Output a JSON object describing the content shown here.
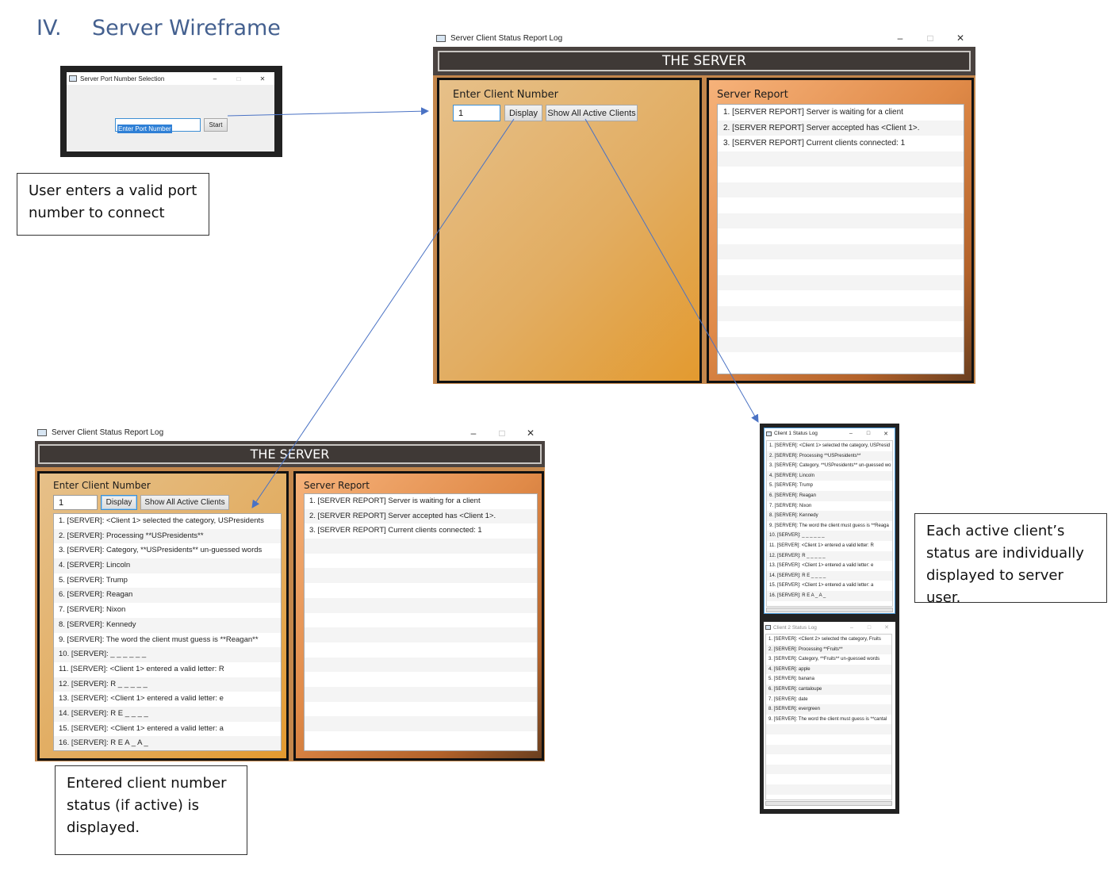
{
  "section": {
    "numeral": "IV.",
    "title": "Server Wireframe"
  },
  "port_window": {
    "title": "Server Port Number Selection",
    "controls": {
      "min": "–",
      "max": "□",
      "close": "✕"
    },
    "port_input_value": "Enter Port Number",
    "start_label": "Start"
  },
  "callouts": {
    "port": "User enters a valid port number to connect",
    "client_status": "Entered client number status (if active) is displayed.",
    "active_clients": "Each active client’s status are individually displayed to server user."
  },
  "server_window": {
    "title": "Server Client Status Report Log",
    "banner": "THE SERVER",
    "controls": {
      "min": "–",
      "max": "□",
      "close": "✕"
    },
    "enter_label": "Enter Client Number",
    "client_input_value": "1",
    "display_label": "Display",
    "show_all_label": "Show All Active Clients",
    "report_label": "Server Report",
    "report_lines": [
      "1. [SERVER REPORT] Server is waiting for a client",
      "2. [SERVER REPORT] Server accepted has <Client 1>.",
      "3. [SERVER REPORT] Current clients connected: 1"
    ]
  },
  "client_status_lines": [
    "1. [SERVER]: <Client 1> selected the category, USPresidents",
    "2. [SERVER]: Processing **USPresidents**",
    "3. [SERVER]: Category, **USPresidents** un-guessed words",
    "4. [SERVER]: Lincoln",
    "5. [SERVER]: Trump",
    "6. [SERVER]: Reagan",
    "7. [SERVER]: Nixon",
    "8. [SERVER]: Kennedy",
    "9. [SERVER]: The word the client must guess is **Reagan**",
    "10. [SERVER]: _ _ _ _ _ _",
    "11. [SERVER]: <Client 1> entered a valid letter: R",
    "12. [SERVER]: R _ _ _ _ _",
    "13. [SERVER]: <Client 1> entered a valid letter: e",
    "14. [SERVER]: R E _ _ _ _",
    "15. [SERVER]: <Client 1> entered a valid letter: a",
    "16. [SERVER]: R E A _ A _"
  ],
  "client1_window": {
    "title": "Client 1 Status Log",
    "lines": [
      "1. [SERVER]: <Client 1> selected the category, USPresid",
      "2. [SERVER]: Processing **USPresidents**",
      "3. [SERVER]: Category, **USPresidents** un-guessed wo",
      "4. [SERVER]: Lincoln",
      "5. [SERVER]: Trump",
      "6. [SERVER]: Reagan",
      "7. [SERVER]: Nixon",
      "8. [SERVER]: Kennedy",
      "9. [SERVER]: The word the client must guess is **Reaga",
      "10. [SERVER]: _ _ _ _ _ _",
      "11. [SERVER]: <Client 1> entered a valid letter: R",
      "12. [SERVER]: R _ _ _ _ _",
      "13. [SERVER]: <Client 1> entered a valid letter: e",
      "14. [SERVER]: R E _ _ _ _",
      "15. [SERVER]: <Client 1> entered a valid letter: a",
      "16. [SERVER]: R E A _ A _"
    ]
  },
  "client2_window": {
    "title": "Client 2 Status Log",
    "lines": [
      "1. [SERVER]: <Client 2> selected the category, Fruits",
      "2. [SERVER]: Processing **Fruits**",
      "3. [SERVER]: Category, **Fruits** un-guessed words",
      "4. [SERVER]: apple",
      "5. [SERVER]: banana",
      "6. [SERVER]: cantaloupe",
      "7. [SERVER]: date",
      "8. [SERVER]: evergreen",
      "9. [SERVER]: The word the client must guess is **cantal"
    ]
  },
  "colors": {
    "heading": "#44608f",
    "arrow": "#4a72c4",
    "banner": "#3f3936",
    "left_pane": "#e2ad62",
    "right_pane": "#e08a48"
  }
}
